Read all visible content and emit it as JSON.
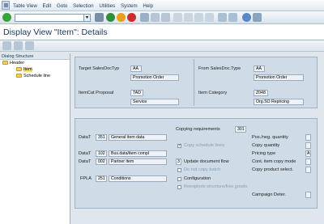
{
  "menu": {
    "items": [
      "Table View",
      "Edit",
      "Goto",
      "Selection",
      "Utilities",
      "System",
      "Help"
    ]
  },
  "title": "Display View \"Item\": Details",
  "dialog_structure": {
    "title": "Dialog Structure",
    "items": [
      {
        "label": "Header"
      },
      {
        "label": "Item"
      },
      {
        "label": "Schedule line"
      }
    ]
  },
  "top_panel": {
    "target_label": "Target SalesDocTyp",
    "target_code": "AA",
    "target_text": "Promotion Order",
    "from_label": "From SalesDoc.Type",
    "from_code": "AA",
    "from_text": "Promotion Order",
    "itemcat_label": "ItemCat Proposal",
    "itemcat_code": "TAD",
    "itemcat_text": "Service",
    "category_label": "Item Category",
    "category_code": "Z048",
    "category_text": "Org.SO Repricing"
  },
  "bottom_panel": {
    "copy_req_label": "Copying requirements",
    "copy_req_value": "301",
    "data_rows": [
      {
        "label": "DataT",
        "code": "351",
        "text": "General item data"
      },
      {
        "label": "DataT",
        "code": "102",
        "text": "Bus.data/item compl"
      },
      {
        "label": "DataT",
        "code": "002",
        "text": "Partner item"
      }
    ],
    "fpla_label": "FPLA",
    "fpla_code": "251",
    "fpla_text": "Conditions",
    "copy_schedule_label": "Copy schedule lines",
    "update_doc_flow_value": "3",
    "update_doc_flow_label": "Update document flow",
    "do_not_copy_batch_label": "Do not copy batch",
    "configuration_label": "Configuration",
    "reexplode_label": "Reexplode structure/free goods",
    "right_labels": [
      "Pos./neg. quantity",
      "Copy quantity",
      "Pricing type",
      "Cont. item copy mode",
      "Copy product select."
    ],
    "pricing_type_value": "A",
    "campaign_label": "Campaign Deter."
  }
}
